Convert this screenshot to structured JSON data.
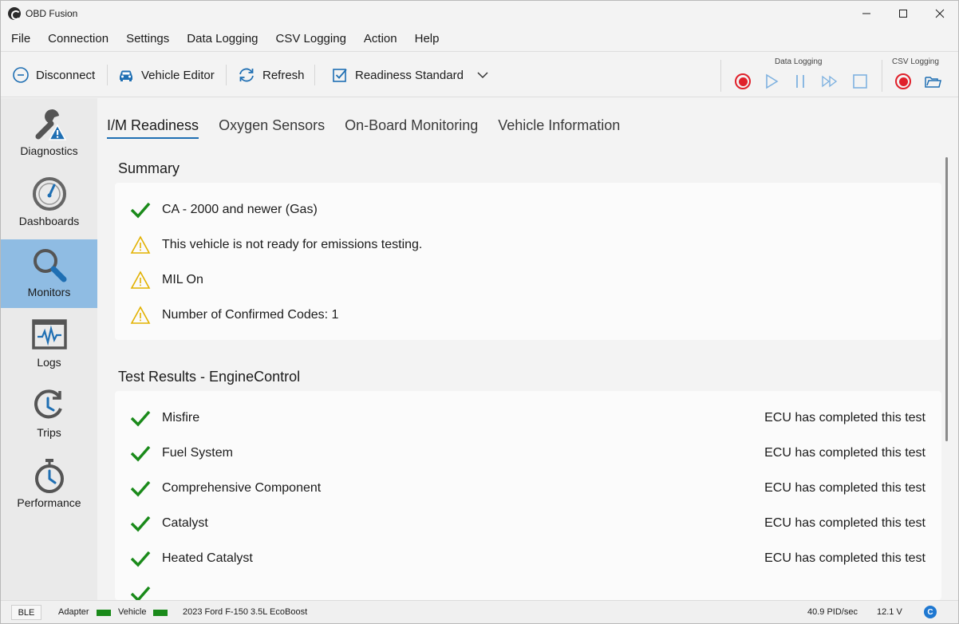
{
  "window": {
    "title": "OBD Fusion",
    "controls": {
      "minimize": "—",
      "maximize": "☐",
      "close": "✕"
    }
  },
  "menu": [
    "File",
    "Connection",
    "Settings",
    "Data Logging",
    "CSV Logging",
    "Action",
    "Help"
  ],
  "toolbar": {
    "disconnect": "Disconnect",
    "vehicle_editor": "Vehicle Editor",
    "refresh": "Refresh",
    "readiness_standard": "Readiness Standard",
    "data_logging_label": "Data Logging",
    "csv_logging_label": "CSV Logging"
  },
  "sidebar": {
    "items": [
      {
        "label": "Diagnostics",
        "icon": "wrench-warning-icon"
      },
      {
        "label": "Dashboards",
        "icon": "gauge-icon"
      },
      {
        "label": "Monitors",
        "icon": "magnifier-icon",
        "active": true
      },
      {
        "label": "Logs",
        "icon": "waveform-icon"
      },
      {
        "label": "Trips",
        "icon": "trip-clock-icon"
      },
      {
        "label": "Performance",
        "icon": "stopwatch-icon"
      }
    ]
  },
  "tabs": [
    "I/M Readiness",
    "Oxygen Sensors",
    "On-Board Monitoring",
    "Vehicle Information"
  ],
  "summary": {
    "title": "Summary",
    "items": [
      {
        "icon": "check-icon",
        "text": "CA - 2000 and newer (Gas)"
      },
      {
        "icon": "warning-icon",
        "text": "This vehicle is not ready for emissions testing."
      },
      {
        "icon": "warning-icon",
        "text": "MIL On"
      },
      {
        "icon": "warning-icon",
        "text": "Number of Confirmed Codes: 1"
      }
    ]
  },
  "test_results": {
    "title": "Test Results - EngineControl",
    "items": [
      {
        "name": "Misfire",
        "status": "ECU has completed this test"
      },
      {
        "name": "Fuel System",
        "status": "ECU has completed this test"
      },
      {
        "name": "Comprehensive Component",
        "status": "ECU has completed this test"
      },
      {
        "name": "Catalyst",
        "status": "ECU has completed this test"
      },
      {
        "name": "Heated Catalyst",
        "status": "ECU has completed this test"
      }
    ]
  },
  "statusbar": {
    "ble": "BLE",
    "adapter": "Adapter",
    "vehicle": "Vehicle",
    "vehicle_name": "2023 Ford F-150 3.5L EcoBoost",
    "rate": "40.9 PID/sec",
    "voltage": "12.1 V",
    "badge": "C"
  },
  "colors": {
    "accent": "#1f6fb3",
    "check": "#1a8a1a",
    "warning": "#e2b100",
    "record": "#e0202a",
    "active_sidebar": "#8fbce3"
  }
}
